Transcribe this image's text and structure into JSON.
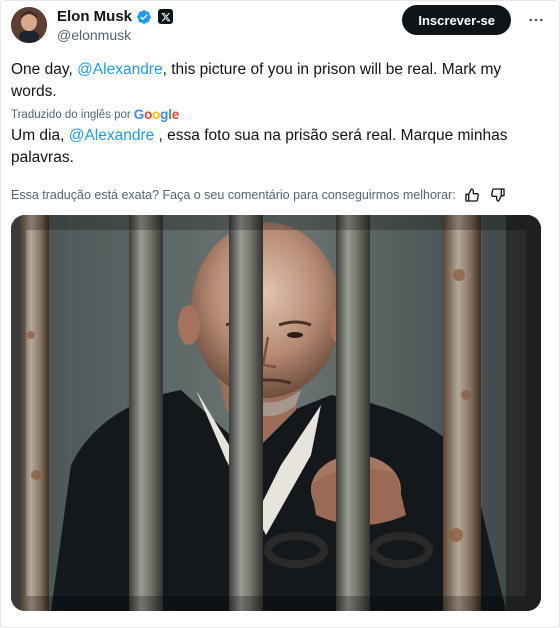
{
  "author": {
    "name": "Elon Musk",
    "handle": "@elonmusk",
    "verified_icon": "verified-badge-icon",
    "affiliation_icon": "x-logo-icon"
  },
  "header": {
    "subscribe_label": "Inscrever-se",
    "more_icon": "more-dots-icon"
  },
  "tweet": {
    "text_before": "One day, ",
    "mention": "@Alexandre",
    "text_after": ", this picture of you in prison will be real. Mark my words."
  },
  "translation": {
    "translated_by": "Traduzido do inglês por",
    "provider": "Google",
    "text_before": "Um dia, ",
    "mention": "@Alexandre",
    "text_after": " , essa foto sua na prisão será real. Marque minhas palavras."
  },
  "feedback": {
    "question": "Essa tradução está exata? Faça o seu comentário para conseguirmos melhorar:",
    "thumbs_up_icon": "thumbs-up-icon",
    "thumbs_down_icon": "thumbs-down-icon"
  },
  "media": {
    "image_subject": "bald man in black robe behind prison bars, hands on bars, wearing handcuffs"
  },
  "colors": {
    "accent": "#1d9bf0",
    "verified": "#1d9bf0",
    "button_bg": "#0f1419",
    "muted_text": "#536471"
  }
}
